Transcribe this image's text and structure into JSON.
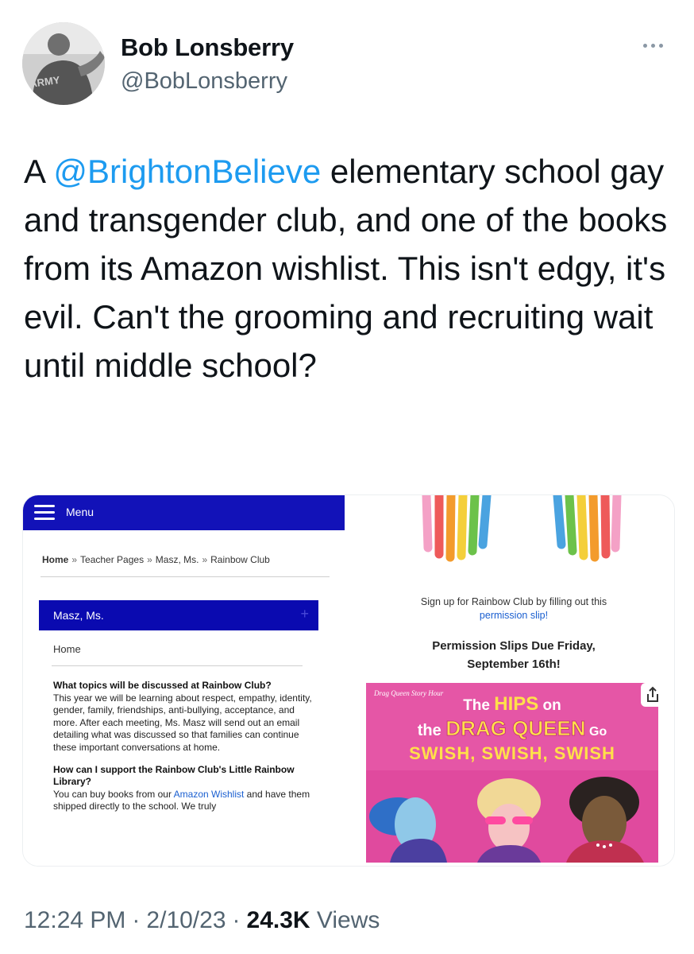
{
  "author": {
    "name": "Bob Lonsberry",
    "handle": "@BobLonsberry",
    "avatar_shirt_text": "ARMY"
  },
  "tweet": {
    "prefix": "A ",
    "mention": "@BrightonBelieve",
    "body": " elementary school gay and transgender club, and one of the books from its Amazon wishlist. This isn't edgy, it's evil. Can't the grooming and recruiting wait until middle school?"
  },
  "image_left": {
    "menu_label": "Menu",
    "breadcrumbs": [
      "Home",
      "Teacher Pages",
      "Masz, Ms.",
      "Rainbow Club"
    ],
    "breadcrumb_sep": "»",
    "teacher_name": "Masz, Ms.",
    "teacher_plus": "+",
    "home_link": "Home",
    "q1": "What topics will be discussed at Rainbow Club?",
    "a1": "This year we will be learning about respect, empathy, identity, gender, family, friendships, anti-bullying, acceptance, and more. After each meeting, Ms. Masz will send out an email detailing what was discussed so that families can continue these important conversations at home.",
    "q2": "How can I support the Rainbow Club's Little Rainbow Library?",
    "a2_before": "You can buy books from our ",
    "a2_link": "Amazon Wishlist",
    "a2_after": " and have them shipped directly to the school. We truly"
  },
  "image_right": {
    "signup_line1": "Sign up for Rainbow Club by filling out this",
    "signup_link": "permission slip!",
    "due_line1": "Permission Slips Due Friday,",
    "due_line2": "September 16th!",
    "book_badge": "Drag Queen Story Hour",
    "book_title_1a": "The ",
    "book_title_1b": "HIPS",
    "book_title_1c": " on",
    "book_title_2a": "the ",
    "book_title_2b": "DRAG QUEEN",
    "book_title_2c": " Go",
    "book_title_3": "SWISH, SWISH, SWISH"
  },
  "footer": {
    "time": "12:24 PM",
    "date": "2/10/23",
    "views_count": "24.3K",
    "views_label": "Views",
    "sep": "·"
  },
  "colors": {
    "link_blue": "#1d9bf0",
    "site_blue": "#1212b8",
    "cover_pink": "#e04a9e",
    "muted_text": "#536471"
  }
}
